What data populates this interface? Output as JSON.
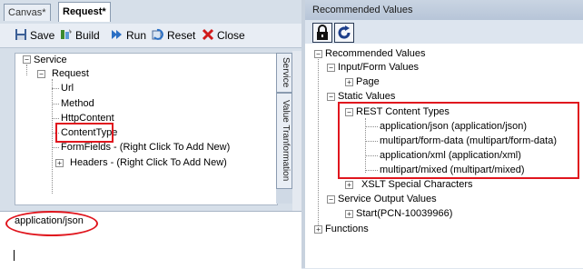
{
  "tabs": [
    {
      "label": "Canvas*",
      "active": false
    },
    {
      "label": "Request*",
      "active": true
    }
  ],
  "toolbar": {
    "save": "Save",
    "build": "Build",
    "run": "Run",
    "reset": "Reset",
    "close": "Close"
  },
  "side_tabs": [
    "Service",
    "Value Tranformation"
  ],
  "left_tree": {
    "service": "Service",
    "request": "Request",
    "url": "Url",
    "method": "Method",
    "httpcontent": "HttpContent",
    "contenttype": "ContentType",
    "formfields": "FormFields - (Right Click To Add New)",
    "headers": "Headers - (Right Click To Add New)"
  },
  "editor": {
    "value": "application/json"
  },
  "right_panel": {
    "title": "Recommended Values",
    "tree": {
      "root": "Recommended Values",
      "input_form": "Input/Form Values",
      "page": "Page",
      "static": "Static Values",
      "rest": "REST Content Types",
      "ct_json": "application/json (application/json)",
      "ct_form": "multipart/form-data (multipart/form-data)",
      "ct_xml": "application/xml (application/xml)",
      "ct_mixed": "multipart/mixed (multipart/mixed)",
      "xslt": "XSLT Special Characters",
      "service_output": "Service Output Values",
      "start": "Start(PCN-10039966)",
      "functions": "Functions"
    }
  },
  "colors": {
    "highlight": "#e0161e",
    "accent": "#2a5fb0"
  }
}
